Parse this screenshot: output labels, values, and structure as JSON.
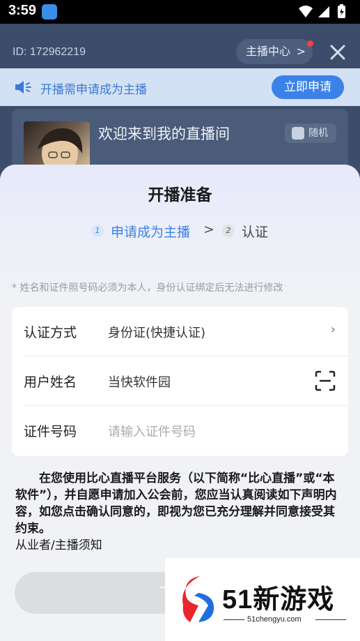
{
  "status_bar": {
    "time": "3:59"
  },
  "header": {
    "id_text": "ID: 172962219",
    "host_center_label": "主播中心",
    "host_center_chevron": ">"
  },
  "notice": {
    "text": "开播需申请成为主播",
    "apply_button": "立即申请"
  },
  "room": {
    "title": "欢迎来到我的直播间",
    "random_label": "随机"
  },
  "sheet": {
    "title": "开播准备",
    "steps": [
      {
        "num": "1",
        "label": "申请成为主播"
      },
      {
        "num": "2",
        "label": "认证"
      }
    ],
    "step_arrow": ">",
    "tip": "* 姓名和证件照号码必须为本人，身份认证绑定后无法进行修改",
    "form": {
      "method_label": "认证方式",
      "method_value": "身份证(快捷认证)",
      "name_label": "用户姓名",
      "name_value": "当快软件园",
      "id_label": "证件号码",
      "id_placeholder": "请输入证件号码"
    },
    "agreement_text": "在您使用比心直播平台服务（以下简称“比心直播”或“本软件”），并自愿申请加入公会前，您应当认真阅读如下声明内容，如您点击确认同意的，即视为您已充分理解并同意接受其约束。",
    "agreement_link": "从业者/主播须知",
    "next_button": "下一步"
  },
  "watermark": {
    "brand": "51新游戏",
    "domain": "51chengyu.com"
  },
  "colors": {
    "accent": "#3b82e8",
    "header_bg": "#3b4d6a",
    "notice_bg": "#d3e1f5",
    "disabled_button": "#dcdde1"
  }
}
